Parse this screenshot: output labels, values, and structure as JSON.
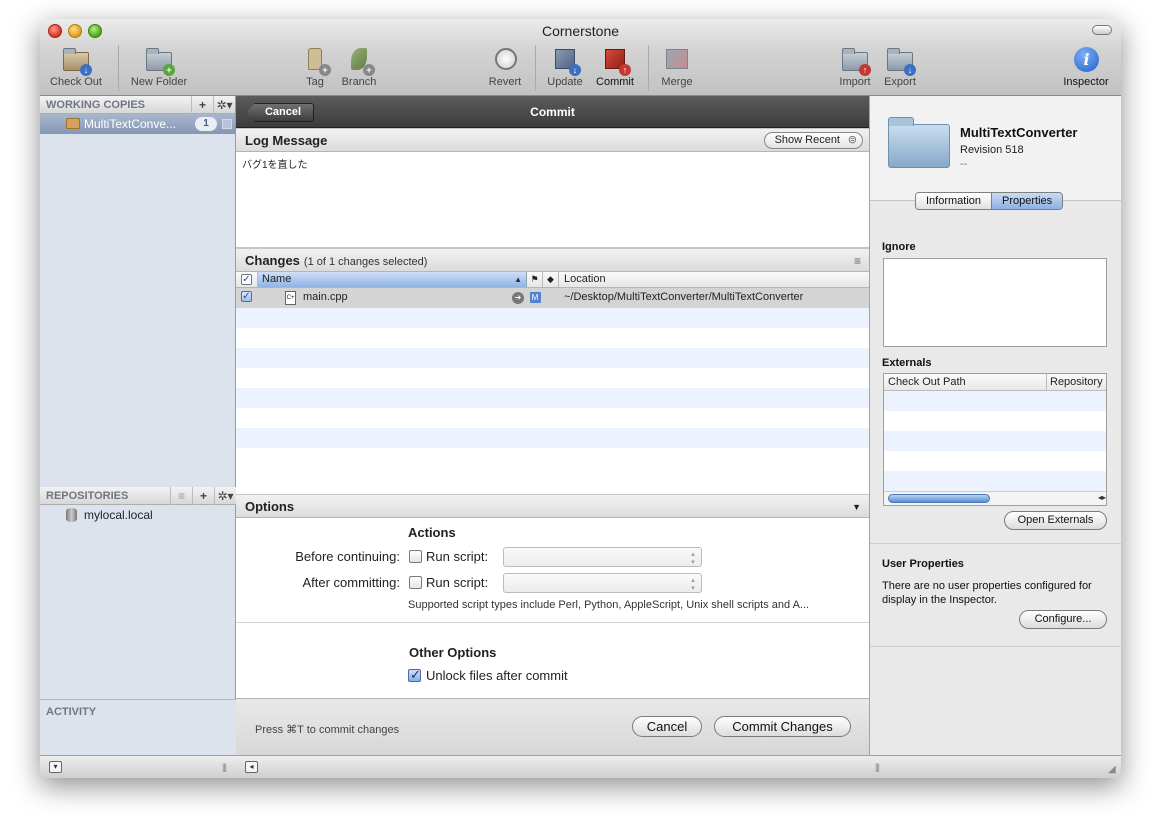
{
  "window": {
    "title": "Cornerstone"
  },
  "toolbar": {
    "check_out": "Check Out",
    "new_folder": "New Folder",
    "tag": "Tag",
    "branch": "Branch",
    "revert": "Revert",
    "update": "Update",
    "commit": "Commit",
    "merge": "Merge",
    "import": "Import",
    "export": "Export",
    "inspector": "Inspector"
  },
  "sidebar": {
    "working_copies_header": "WORKING COPIES",
    "working_copy": {
      "name": "MultiTextConve...",
      "count": "1"
    },
    "repositories_header": "REPOSITORIES",
    "repositories": [
      {
        "name": "mylocal.local"
      }
    ],
    "activity_header": "ACTIVITY"
  },
  "commit": {
    "cancel_back": "Cancel",
    "title": "Commit",
    "log_header": "Log Message",
    "show_recent": "Show Recent",
    "log_text": "バグ1を直した",
    "changes_header": "Changes",
    "changes_sub": "(1 of 1 changes selected)",
    "columns": {
      "name": "Name",
      "location": "Location"
    },
    "rows": [
      {
        "name": "main.cpp",
        "status": "M",
        "location": "~/Desktop/MultiTextConverter/MultiTextConverter",
        "checked": true
      }
    ],
    "options_header": "Options",
    "actions_header": "Actions",
    "before_label": "Before continuing:",
    "after_label": "After committing:",
    "run_script": "Run script:",
    "script_note": "Supported script types include Perl, Python, AppleScript, Unix shell scripts and A...",
    "other_options_header": "Other Options",
    "unlock_label": "Unlock files after commit",
    "hint": "Press ⌘T to commit changes",
    "cancel_button": "Cancel",
    "commit_button": "Commit Changes"
  },
  "inspector": {
    "name": "MultiTextConverter",
    "revision": "Revision 518",
    "dash": "--",
    "tabs": [
      "Information",
      "Properties"
    ],
    "active_tab": "Properties",
    "ignore_label": "Ignore",
    "externals_label": "Externals",
    "externals_columns": [
      "Check Out Path",
      "Repository"
    ],
    "open_externals": "Open Externals",
    "user_properties_label": "User Properties",
    "user_properties_text": "There are no user properties configured for display in the Inspector.",
    "configure": "Configure..."
  }
}
